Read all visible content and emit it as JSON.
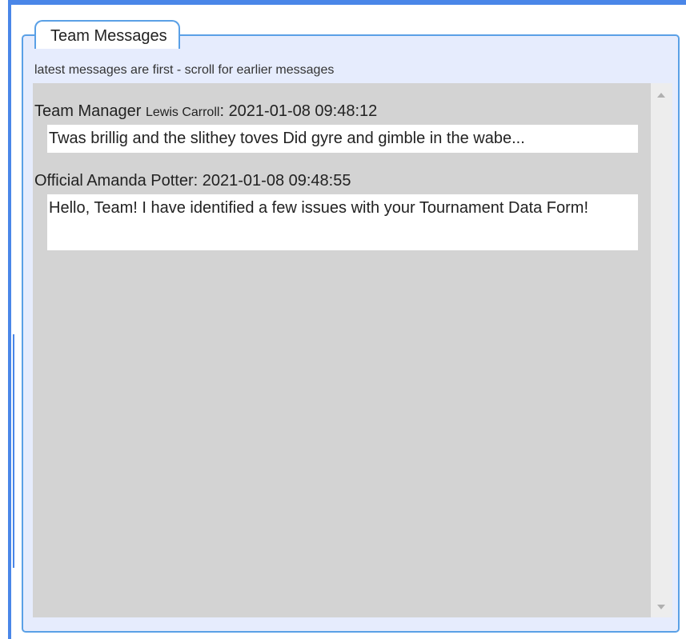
{
  "panel": {
    "title": "Team Messages",
    "hint": "latest messages are first - scroll for earlier messages"
  },
  "messages": [
    {
      "role": "Team Manager",
      "name": "Lewis Carroll",
      "timestamp": "2021-01-08 09:48:12",
      "text": "Twas brillig and the slithey toves Did gyre and gimble in the wabe..."
    },
    {
      "role": "Official",
      "name": "Amanda Potter",
      "timestamp": "2021-01-08 09:48:55",
      "text": "Hello, Team! I have identified a few issues with your Tournament Data Form!"
    }
  ],
  "colors": {
    "accent": "#4a86e8",
    "panel_border": "#5aa0e6",
    "panel_bg": "#e6ecfd",
    "messages_bg": "#d3d3d3"
  },
  "icons": {
    "scroll_up": "scroll-up-arrow-icon",
    "scroll_down": "scroll-down-arrow-icon"
  }
}
